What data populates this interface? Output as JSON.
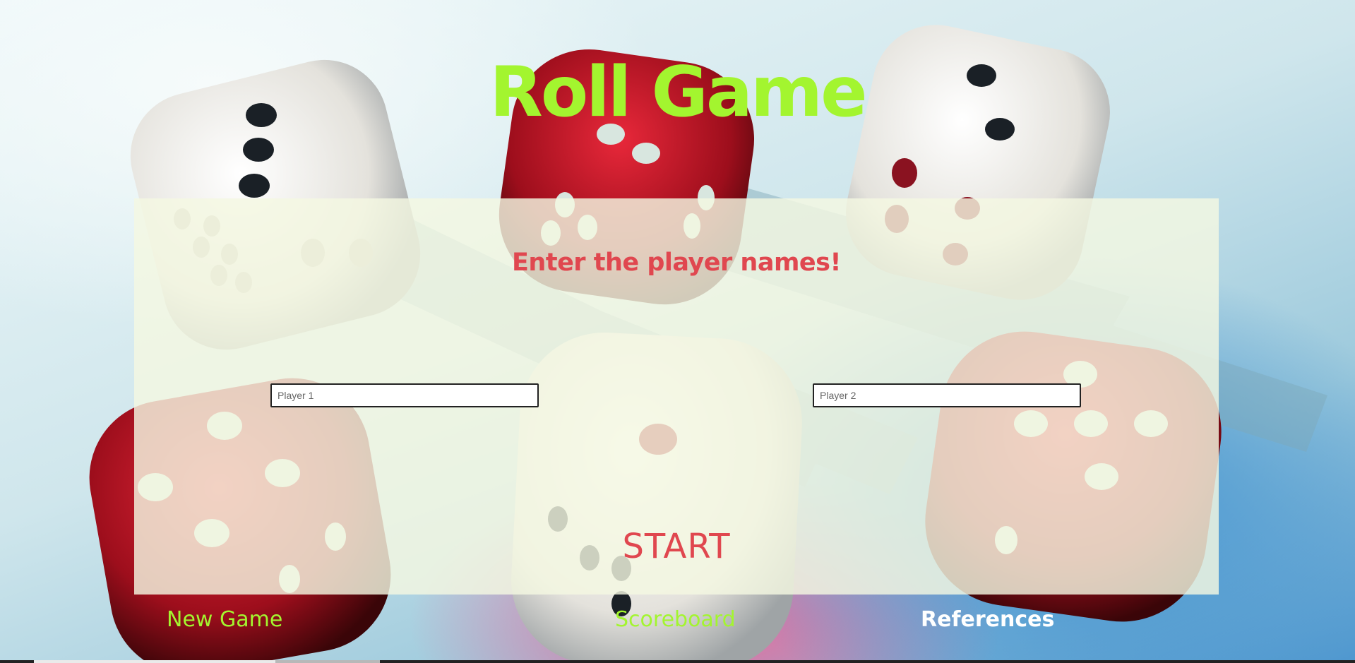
{
  "app": {
    "title": "Roll Game"
  },
  "setup": {
    "heading": "Enter the player names!",
    "player1_placeholder": "Player 1",
    "player2_placeholder": "Player 2",
    "start_label": "START"
  },
  "nav": {
    "items": [
      {
        "label": "New Game",
        "color": "#a3f52f"
      },
      {
        "label": "Scoreboard",
        "color": "#a3f52f"
      },
      {
        "label": "References",
        "color": "#ffffff"
      }
    ]
  },
  "colors": {
    "title": "#a3f52f",
    "accent": "#e0474f",
    "panel": "#f4f8e2"
  },
  "background": {
    "icon": "dice-photo"
  }
}
